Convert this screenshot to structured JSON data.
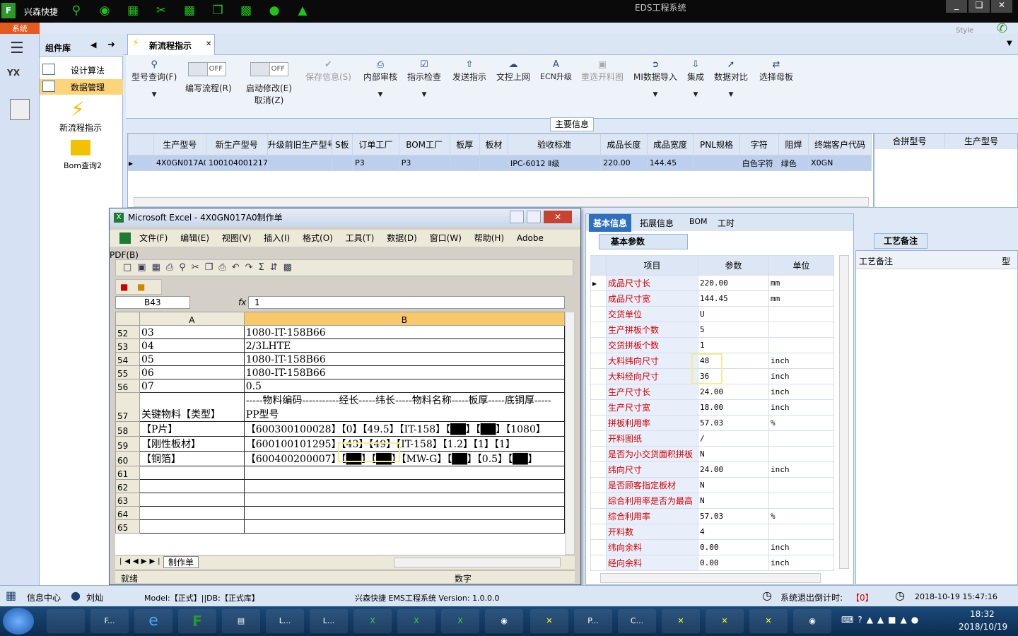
{
  "app": {
    "name": "兴森快捷",
    "window_title": "EDS工程系统",
    "system_tab": "系统",
    "style_label": "Style"
  },
  "left_panel": {
    "title": "组件库",
    "items": [
      {
        "label": "设计算法"
      },
      {
        "label": "数据管理"
      }
    ],
    "tiles": [
      {
        "label": "新流程指示"
      },
      {
        "label": "Bom查询2"
      }
    ]
  },
  "doc_tab": {
    "label": "新流程指示"
  },
  "ribbon": {
    "off_label": "OFF",
    "buttons": [
      {
        "label": "型号查询(F)"
      },
      {
        "label": "编写流程(R)"
      },
      {
        "label": "启动修改(E)",
        "sub": "取消(Z)"
      },
      {
        "label": "保存信息(S)"
      },
      {
        "label": "内部审核"
      },
      {
        "label": "指示检查"
      },
      {
        "label": "发送指示"
      },
      {
        "label": "文控上网"
      },
      {
        "label": "ECN升级"
      },
      {
        "label": "重选开料图"
      },
      {
        "label": "MI数据导入"
      },
      {
        "label": "集成"
      },
      {
        "label": "数据对比"
      },
      {
        "label": "选择母板"
      }
    ]
  },
  "main_info": {
    "title": "主要信息",
    "columns": [
      "生产型号",
      "新生产型号",
      "升级前旧生产型号",
      "S板",
      "订单工厂",
      "BOM工厂",
      "板厚",
      "板材",
      "验收标准",
      "成品长度",
      "成品宽度",
      "PNL规格",
      "字符",
      "阻焊",
      "终端客户代码"
    ],
    "row": [
      "4X0GN017A0",
      "10010400121747",
      "",
      "",
      "P3",
      "P3",
      "",
      "",
      "IPC-6012 Ⅱ级",
      "220.00",
      "144.45",
      "",
      "白色字符",
      "绿色",
      "X0GN"
    ],
    "side_columns": [
      "合拼型号",
      "生产型号"
    ]
  },
  "excel": {
    "title": "Microsoft Excel - 4X0GN017A0制作单",
    "menu": [
      "文件(F)",
      "编辑(E)",
      "视图(V)",
      "插入(I)",
      "格式(O)",
      "工具(T)",
      "数据(D)",
      "窗口(W)",
      "帮助(H)",
      "Adobe PDF(B)"
    ],
    "cell_ref": "B43",
    "fx": "fx",
    "formula": "1",
    "col_a": "A",
    "col_b": "B",
    "rows": [
      {
        "n": "52",
        "a": "03",
        "b": "1080-IT-158B66"
      },
      {
        "n": "53",
        "a": "04",
        "b": "2/3LHTE"
      },
      {
        "n": "54",
        "a": "05",
        "b": "1080-IT-158B66"
      },
      {
        "n": "55",
        "a": "06",
        "b": "1080-IT-158B66"
      },
      {
        "n": "56",
        "a": "07",
        "b": "0.5"
      },
      {
        "n": "57",
        "a": "关键物料【类型】",
        "b": "-----物料编码-----------经长-----纬长-----物料名称-----板厚-----底铜厚-----PP型号"
      },
      {
        "n": "58",
        "a": "【P片】",
        "b": "【600300100028】【0】【49.5】【IT-158】【██】【██】【1080】"
      },
      {
        "n": "59",
        "a": "【刚性板材】",
        "b": "【600100101295】【43】【49】【IT-158】【1.2】【1】【1】"
      },
      {
        "n": "60",
        "a": "【铜箔】",
        "b": "【600400200007】【██】【██】【MW-G】【██】【0.5】【██】"
      },
      {
        "n": "61",
        "a": "",
        "b": ""
      },
      {
        "n": "62",
        "a": "",
        "b": ""
      },
      {
        "n": "63",
        "a": "",
        "b": ""
      },
      {
        "n": "64",
        "a": "",
        "b": ""
      },
      {
        "n": "65",
        "a": "",
        "b": ""
      }
    ],
    "sheet_tab": "制作单",
    "status_left": "就绪",
    "status_mid": "数字"
  },
  "param_tabs": [
    "基本信息",
    "拓展信息",
    "BOM",
    "工时"
  ],
  "params": {
    "title": "基本参数",
    "headers": [
      "项目",
      "参数",
      "单位"
    ],
    "rows": [
      {
        "k": "成品尺寸长",
        "v": "220.00",
        "u": "mm"
      },
      {
        "k": "成品尺寸宽",
        "v": "144.45",
        "u": "mm"
      },
      {
        "k": "交货单位",
        "v": "U",
        "u": ""
      },
      {
        "k": "生产拼板个数",
        "v": "5",
        "u": ""
      },
      {
        "k": "交货拼板个数",
        "v": "1",
        "u": ""
      },
      {
        "k": "大料纬向尺寸",
        "v": "48",
        "u": "inch"
      },
      {
        "k": "大料经向尺寸",
        "v": "36",
        "u": "inch"
      },
      {
        "k": "生产尺寸长",
        "v": "24.00",
        "u": "inch"
      },
      {
        "k": "生产尺寸宽",
        "v": "18.00",
        "u": "inch"
      },
      {
        "k": "拼板利用率",
        "v": "57.03",
        "u": "%"
      },
      {
        "k": "开料图纸",
        "v": "/",
        "u": ""
      },
      {
        "k": "是否为小交货面积拼板",
        "v": "N",
        "u": ""
      },
      {
        "k": "纬向尺寸",
        "v": "24.00",
        "u": "inch"
      },
      {
        "k": "是否顾客指定板材",
        "v": "N",
        "u": ""
      },
      {
        "k": "综合利用率是否为最高",
        "v": "N",
        "u": ""
      },
      {
        "k": "综合利用率",
        "v": "57.03",
        "u": "%"
      },
      {
        "k": "开料数",
        "v": "4",
        "u": ""
      },
      {
        "k": "纬向余料",
        "v": "0.00",
        "u": "inch"
      },
      {
        "k": "经向余料",
        "v": "0.00",
        "u": "inch"
      }
    ]
  },
  "craft": {
    "title": "工艺备注",
    "header": "工艺备注",
    "col2": "型"
  },
  "status": {
    "info_center": "信息中心",
    "user": "刘灿",
    "model": "Model:【正式】||DB:【正式库】",
    "version": "兴森快捷 EMS工程系统 Version: 1.0.0.0",
    "countdown_label": "系统退出倒计时:",
    "countdown": "【0】",
    "datetime": "2018-10-19 15:47:16"
  },
  "taskbar": {
    "time": "18:32",
    "date": "2018/10/19",
    "items": [
      "F...",
      "L...",
      "L...",
      "P...",
      "C..."
    ]
  }
}
